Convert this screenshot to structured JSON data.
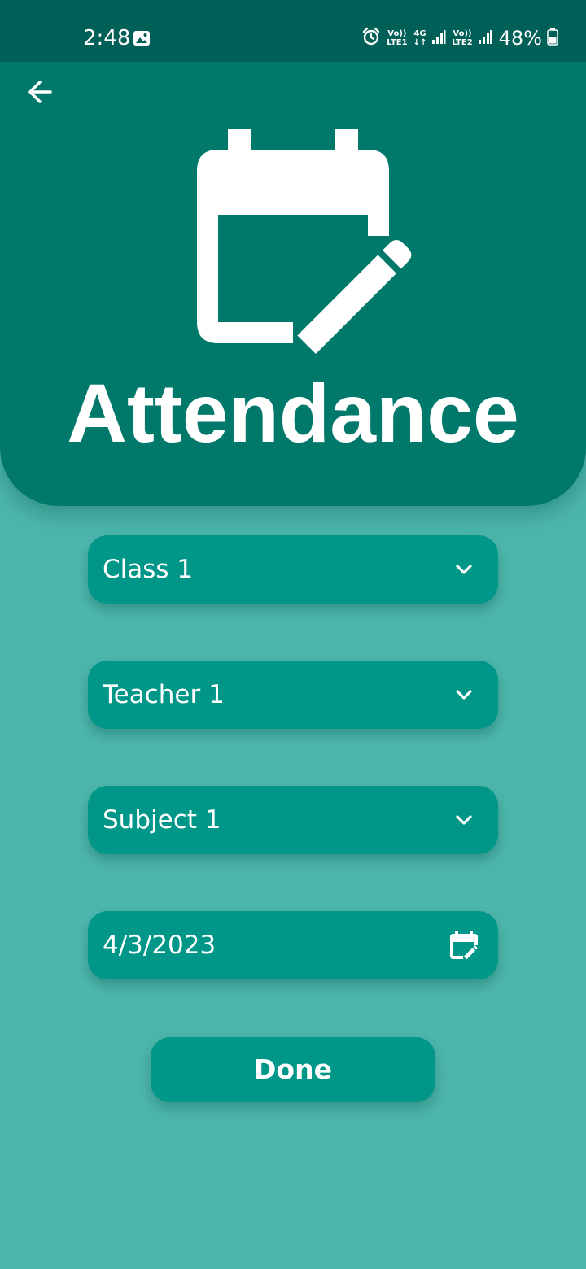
{
  "status_bar": {
    "time": "2:48",
    "gallery_icon": "image-icon",
    "alarm_icon": "alarm-icon",
    "sim1_top": "Vo))",
    "sim1_bottom": "LTE1",
    "network_type": "4G",
    "sim2_top": "Vo))",
    "sim2_bottom": "LTE2",
    "battery_percent": "48%"
  },
  "header": {
    "back_icon": "arrow-left-icon",
    "hero_icon": "calendar-edit-icon",
    "title": "Attendance"
  },
  "form": {
    "class_value": "Class 1",
    "teacher_value": "Teacher 1",
    "subject_value": "Subject 1",
    "date_value": "4/3/2023",
    "dropdown_icon": "chevron-down-icon",
    "date_icon": "calendar-edit-icon"
  },
  "actions": {
    "done_label": "Done"
  },
  "colors": {
    "status_bar": "#005f56",
    "header": "#00796b",
    "background": "#4db6ac",
    "field": "#009688",
    "text": "#ffffff"
  }
}
